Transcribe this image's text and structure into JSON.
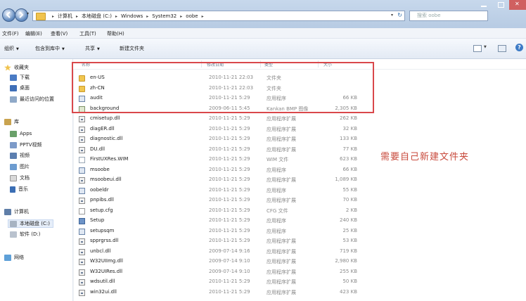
{
  "address": {
    "crumbs": [
      "计算机",
      "本地磁盘 (C:)",
      "Windows",
      "System32",
      "oobe"
    ],
    "search_placeholder": "搜索 oobe"
  },
  "menu": [
    "文件(F)",
    "编辑(E)",
    "查看(V)",
    "工具(T)",
    "帮助(H)"
  ],
  "toolbar": {
    "organize": "组织",
    "include": "包含到库中",
    "share": "共享",
    "new_folder": "新建文件夹"
  },
  "sidebar": {
    "favorites": "收藏夹",
    "downloads": "下载",
    "desktop": "桌面",
    "recent": "最近访问的位置",
    "libraries": "库",
    "apps": "Apps",
    "pptv": "PPTV视频",
    "video": "视频",
    "pictures": "图片",
    "documents": "文档",
    "music": "音乐",
    "computer": "计算机",
    "local_disk": "本地磁盘 (C:)",
    "software_disk": "软件 (D:)",
    "network": "网络"
  },
  "columns": {
    "name": "名称",
    "date": "修改日期",
    "type": "类型",
    "size": "大小"
  },
  "files": [
    {
      "name": "en-US",
      "date": "2010-11-21 22:03",
      "type": "文件夹",
      "size": "",
      "icon": "folder"
    },
    {
      "name": "zh-CN",
      "date": "2010-11-21 22:03",
      "type": "文件夹",
      "size": "",
      "icon": "folder"
    },
    {
      "name": "audit",
      "date": "2010-11-21 5:29",
      "type": "应用程序",
      "size": "66 KB",
      "icon": "exe"
    },
    {
      "name": "background",
      "date": "2009-06-11 5:45",
      "type": "Kankan BMP 图像",
      "size": "2,305 KB",
      "icon": "bmp"
    },
    {
      "name": "cmisetup.dll",
      "date": "2010-11-21 5:29",
      "type": "应用程序扩展",
      "size": "262 KB",
      "icon": "dll"
    },
    {
      "name": "diagER.dll",
      "date": "2010-11-21 5:29",
      "type": "应用程序扩展",
      "size": "32 KB",
      "icon": "dll"
    },
    {
      "name": "diagnostic.dll",
      "date": "2010-11-21 5:29",
      "type": "应用程序扩展",
      "size": "133 KB",
      "icon": "dll"
    },
    {
      "name": "DU.dll",
      "date": "2010-11-21 5:29",
      "type": "应用程序扩展",
      "size": "77 KB",
      "icon": "dll"
    },
    {
      "name": "FirstUXRes.WIM",
      "date": "2010-11-21 5:29",
      "type": "WIM 文件",
      "size": "623 KB",
      "icon": "wim"
    },
    {
      "name": "msoobe",
      "date": "2010-11-21 5:29",
      "type": "应用程序",
      "size": "66 KB",
      "icon": "exe"
    },
    {
      "name": "msoobeui.dll",
      "date": "2010-11-21 5:29",
      "type": "应用程序扩展",
      "size": "1,089 KB",
      "icon": "dll"
    },
    {
      "name": "oobeldr",
      "date": "2010-11-21 5:29",
      "type": "应用程序",
      "size": "55 KB",
      "icon": "exe"
    },
    {
      "name": "pnpibs.dll",
      "date": "2010-11-21 5:29",
      "type": "应用程序扩展",
      "size": "70 KB",
      "icon": "dll"
    },
    {
      "name": "setup.cfg",
      "date": "2010-11-21 5:29",
      "type": "CFG 文件",
      "size": "2 KB",
      "icon": "cfg"
    },
    {
      "name": "Setup",
      "date": "2010-11-21 5:29",
      "type": "应用程序",
      "size": "240 KB",
      "icon": "setup"
    },
    {
      "name": "setupsqm",
      "date": "2010-11-21 5:29",
      "type": "应用程序",
      "size": "25 KB",
      "icon": "exe"
    },
    {
      "name": "spprgrss.dll",
      "date": "2010-11-21 5:29",
      "type": "应用程序扩展",
      "size": "53 KB",
      "icon": "dll"
    },
    {
      "name": "unbcl.dll",
      "date": "2009-07-14 9:16",
      "type": "应用程序扩展",
      "size": "719 KB",
      "icon": "dll"
    },
    {
      "name": "W32UIImg.dll",
      "date": "2009-07-14 9:10",
      "type": "应用程序扩展",
      "size": "2,980 KB",
      "icon": "dll"
    },
    {
      "name": "W32UIRes.dll",
      "date": "2009-07-14 9:10",
      "type": "应用程序扩展",
      "size": "255 KB",
      "icon": "dll"
    },
    {
      "name": "wdsutil.dll",
      "date": "2010-11-21 5:29",
      "type": "应用程序扩展",
      "size": "50 KB",
      "icon": "dll"
    },
    {
      "name": "win32ui.dll",
      "date": "2010-11-21 5:29",
      "type": "应用程序扩展",
      "size": "423 KB",
      "icon": "dll"
    }
  ],
  "annotation": "需要自己新建文件夹",
  "colors": {
    "highlight": "#d9484b",
    "annotation_text": "#c84a3c"
  }
}
